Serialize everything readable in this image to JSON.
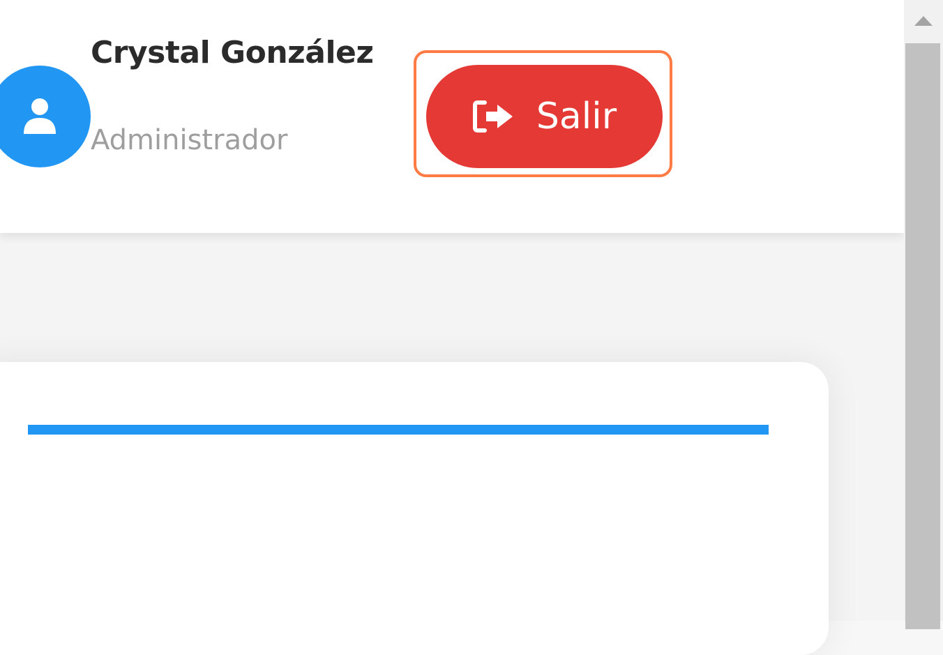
{
  "user": {
    "name": "Crystal González",
    "role": "Administrador",
    "avatar_icon": "user-icon"
  },
  "logout": {
    "label": "Salir",
    "icon": "sign-out-icon"
  },
  "colors": {
    "accent_blue": "#2196f3",
    "logout_red": "#e53935",
    "highlight_orange": "#ff7b45"
  },
  "scrollbar": {
    "up_icon": "arrow-up-icon"
  }
}
